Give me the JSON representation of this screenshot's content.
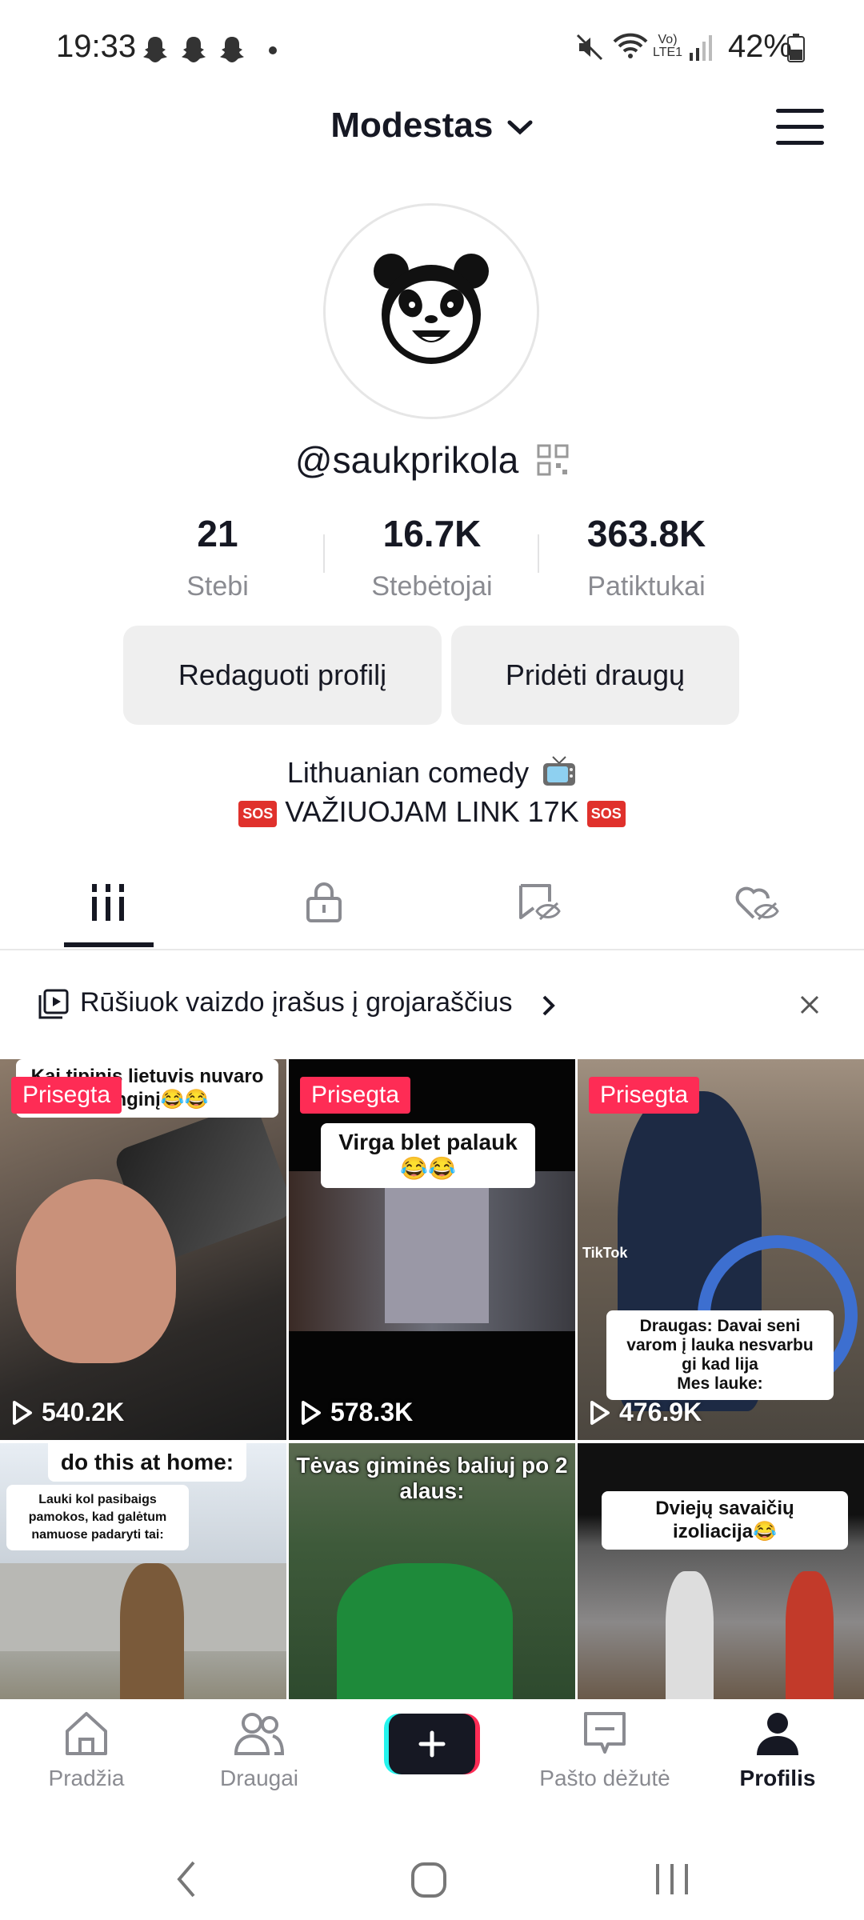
{
  "status_bar": {
    "time": "19:33",
    "battery": "42%"
  },
  "header": {
    "title": "Modestas"
  },
  "profile": {
    "username": "@saukprikola",
    "stats": [
      {
        "value": "21",
        "label": "Stebi"
      },
      {
        "value": "16.7K",
        "label": "Stebėtojai"
      },
      {
        "value": "363.8K",
        "label": "Patiktukai"
      }
    ],
    "edit_button": "Redaguoti profilį",
    "add_friends_button": "Pridėti draugų",
    "bio_line1": "Lithuanian comedy",
    "bio_line2": "VAŽIUOJAM LINK 17K",
    "sos_badge": "SOS"
  },
  "playlist_banner": {
    "text": "Rūšiuok vaizdo įrašus į grojaraščius"
  },
  "videos": [
    {
      "pinned": "Prisegta",
      "caption": "Kai tipinis lietuvis nuvaro į renginį😂😂",
      "views": "540.2K"
    },
    {
      "pinned": "Prisegta",
      "caption": "Virga blet palauk😂😂",
      "views": "578.3K"
    },
    {
      "pinned": "Prisegta",
      "caption": "Draugas: Davai seni varom į lauka nesvarbu gi kad lija\nMes lauke:",
      "views": "476.9K",
      "watermark": "TikTok"
    },
    {
      "caption": "do this at home:",
      "caption2": "Lauki kol pasibaigs pamokos, kad galėtum namuose padaryti tai:"
    },
    {
      "caption": "Tėvas giminės baliuj po 2 alaus:"
    },
    {
      "caption": "Dviejų savaičių izoliacija😂"
    }
  ],
  "bottom_nav": [
    {
      "label": "Pradžia",
      "icon": "home-icon"
    },
    {
      "label": "Draugai",
      "icon": "friends-icon"
    },
    {
      "label": "",
      "icon": "plus-icon"
    },
    {
      "label": "Pašto dėžutė",
      "icon": "inbox-icon"
    },
    {
      "label": "Profilis",
      "icon": "profile-icon"
    }
  ],
  "colors": {
    "accent": "#fe2c55",
    "text": "#161823",
    "muted": "#8a8b91"
  }
}
